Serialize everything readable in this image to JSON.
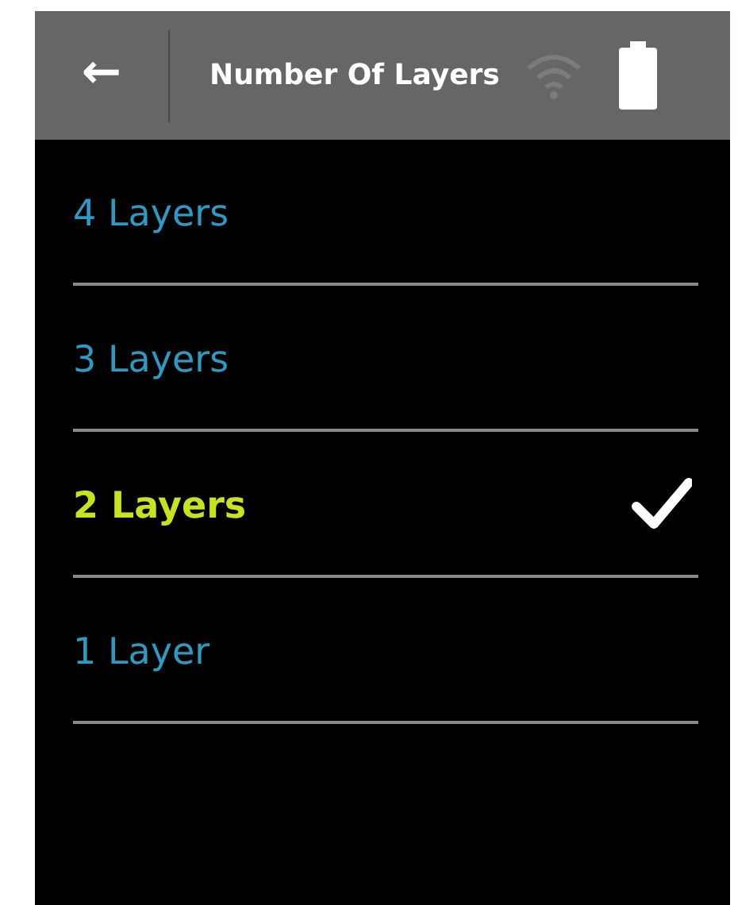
{
  "header": {
    "back": "←",
    "title": "Number Of Layers"
  },
  "options": [
    {
      "label": "4 Layers",
      "selected": false
    },
    {
      "label": "3 Layers",
      "selected": false
    },
    {
      "label": "2 Layers",
      "selected": true
    },
    {
      "label": "1 Layer",
      "selected": false
    }
  ]
}
